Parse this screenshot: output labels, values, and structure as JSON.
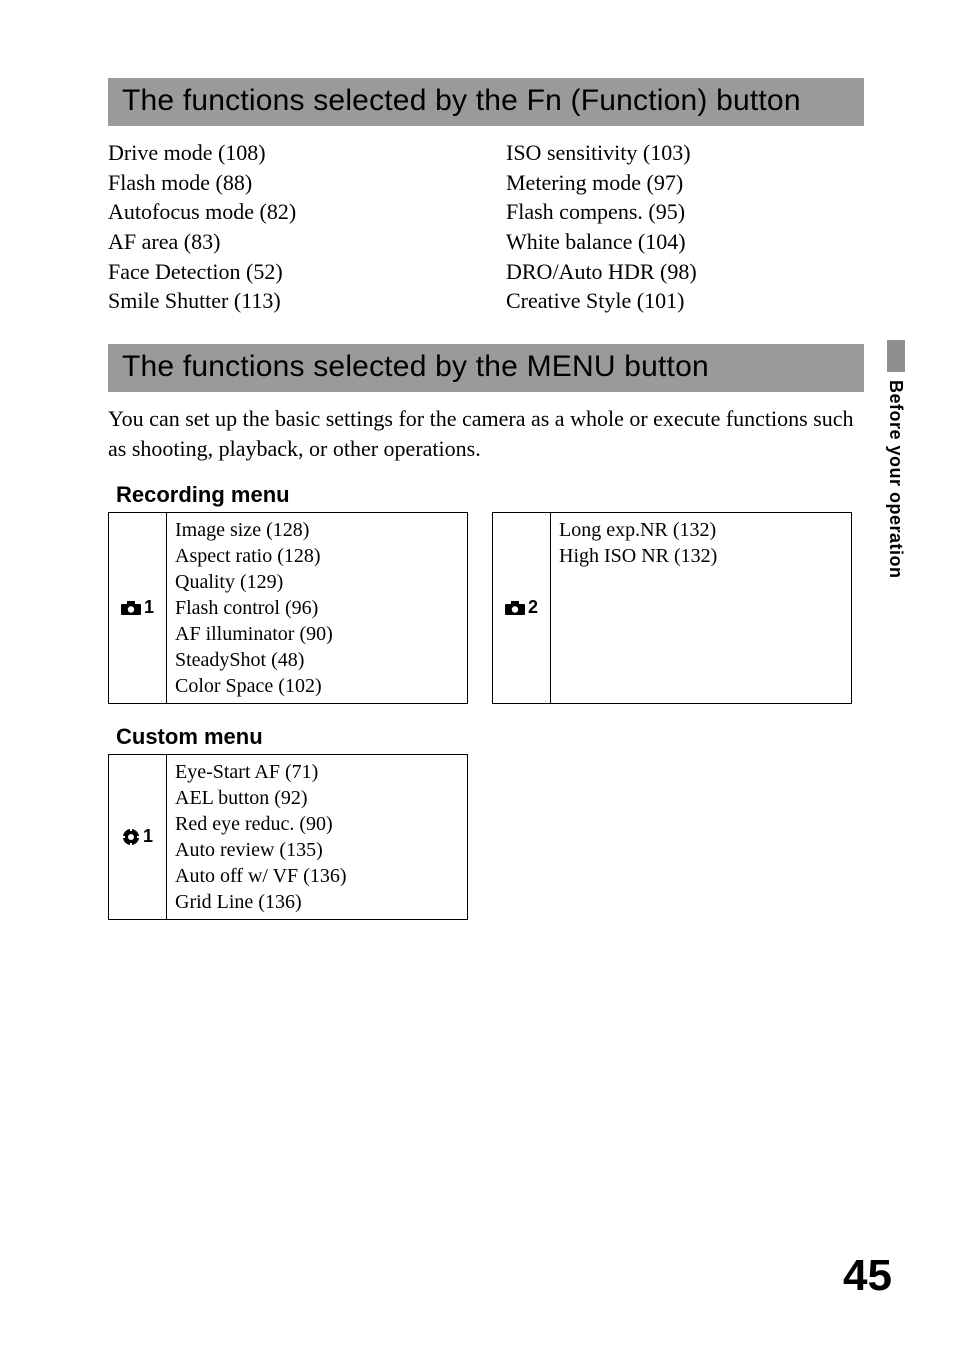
{
  "sections": {
    "fn_title": "The functions selected by the Fn (Function) button",
    "menu_title": "The functions selected by the MENU button"
  },
  "fn_functions": {
    "left": [
      "Drive mode (108)",
      "Flash mode (88)",
      "Autofocus mode (82)",
      "AF area (83)",
      "Face Detection (52)",
      "Smile Shutter (113)"
    ],
    "right": [
      "ISO sensitivity (103)",
      "Metering mode (97)",
      "Flash compens. (95)",
      "White balance (104)",
      "DRO/Auto HDR (98)",
      "Creative Style (101)"
    ]
  },
  "menu_intro": "You can set up the basic settings for the camera as a whole or execute functions such as shooting, playback, or other operations.",
  "recording_menu": {
    "title": "Recording menu",
    "tab1_label": "1",
    "tab1_items": [
      "Image size (128)",
      "Aspect ratio (128)",
      "Quality (129)",
      "Flash control (96)",
      "AF illuminator (90)",
      "SteadyShot (48)",
      "Color Space (102)"
    ],
    "tab2_label": "2",
    "tab2_items": [
      "Long exp.NR (132)",
      "High ISO NR (132)"
    ]
  },
  "custom_menu": {
    "title": "Custom menu",
    "tab1_label": "1",
    "tab1_items": [
      "Eye-Start AF (71)",
      "AEL button (92)",
      "Red eye reduc. (90)",
      "Auto review (135)",
      "Auto off w/ VF (136)",
      "Grid Line (136)"
    ]
  },
  "side_tab": "Before your operation",
  "page_number": "45"
}
